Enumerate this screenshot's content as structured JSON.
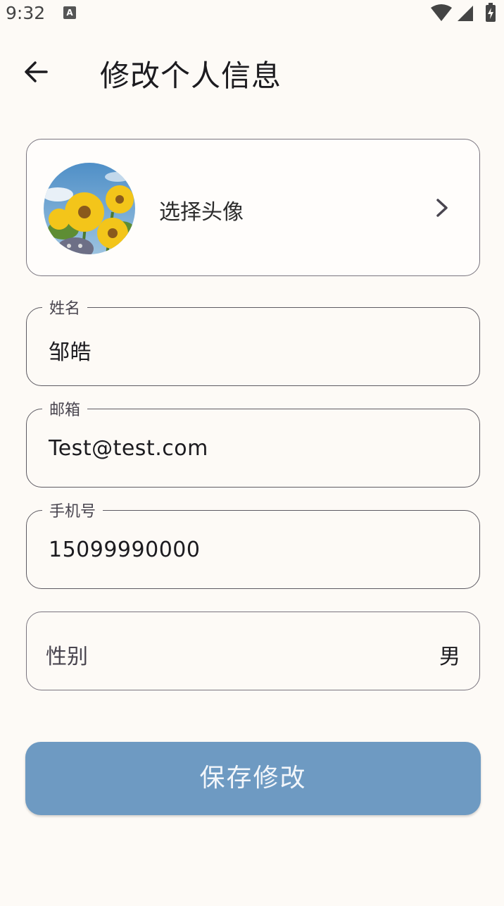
{
  "status_bar": {
    "time": "9:32",
    "notification_badge": "A",
    "icons": [
      "wifi-icon",
      "signal-icon",
      "battery-charging-icon"
    ]
  },
  "app_bar": {
    "back_icon": "arrow-left-icon",
    "title": "修改个人信息"
  },
  "avatar_card": {
    "label": "选择头像",
    "chevron_icon": "chevron-right-icon"
  },
  "form": {
    "name": {
      "label": "姓名",
      "value": "邹皓"
    },
    "email": {
      "label": "邮箱",
      "value": "Test@test.com"
    },
    "phone": {
      "label": "手机号",
      "value": "15099990000"
    },
    "gender": {
      "label": "性别",
      "value": "男"
    }
  },
  "actions": {
    "save_label": "保存修改"
  },
  "colors": {
    "background": "#fdfaf6",
    "primary_button": "#6e9ac2",
    "outline": "#79747e"
  }
}
